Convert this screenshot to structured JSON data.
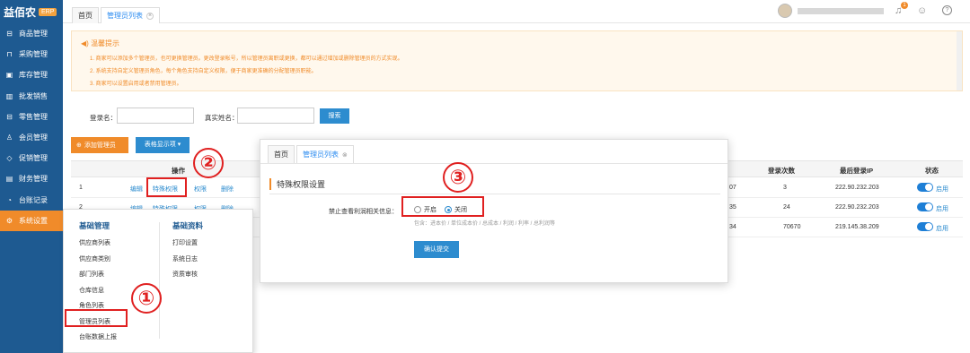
{
  "app": {
    "logo": "益佰农",
    "badge": "ERP"
  },
  "sidebar": [
    {
      "label": "商品管理",
      "icon": "bag-icon",
      "glyph": "⊟"
    },
    {
      "label": "采购管理",
      "icon": "cart-icon",
      "glyph": "⊓"
    },
    {
      "label": "库存管理",
      "icon": "box-icon",
      "glyph": "▣"
    },
    {
      "label": "批发销售",
      "icon": "chart-icon",
      "glyph": "▥"
    },
    {
      "label": "零售管理",
      "icon": "store-icon",
      "glyph": "⊟"
    },
    {
      "label": "会员管理",
      "icon": "user-icon",
      "glyph": "♙"
    },
    {
      "label": "促销管理",
      "icon": "tag-icon",
      "glyph": "◇"
    },
    {
      "label": "财务管理",
      "icon": "wallet-icon",
      "glyph": "▤"
    },
    {
      "label": "台账记录",
      "icon": "clock-icon",
      "glyph": "◔"
    },
    {
      "label": "系统设置",
      "icon": "gear-icon",
      "glyph": "⚙",
      "active": true
    }
  ],
  "tabs": {
    "home": "首页",
    "current": "管理员列表"
  },
  "notice": {
    "title": "温馨提示",
    "lines": [
      "1. 商家可以添加多个管理员，也可更换管理员。更改登录帐号，所以管理员离职或更换，都可以通过增加或删除管理员的方式实现。",
      "2. 系统支持自定义管理员角色，每个角色支持自定义权限，便于商家更准确的分配管理员职能。",
      "3. 商家可以设置启用或者禁用管理员。"
    ]
  },
  "search": {
    "login_label": "登录名：",
    "realname_label": "真实姓名：",
    "button": "搜索"
  },
  "toolbar": {
    "add": "添加管理员",
    "columns": "表格显示项 ▾"
  },
  "table": {
    "headers": {
      "op": "操作",
      "count": "登录次数",
      "ip": "最后登录IP",
      "state": "状态"
    },
    "rows": [
      {
        "no": "1",
        "edit": "编辑",
        "perm": "特殊权限",
        "auth": "权限",
        "del": "删除",
        "mid": "07",
        "count": "3",
        "ip": "222.90.232.203",
        "state": "启用"
      },
      {
        "no": "2",
        "edit": "编辑",
        "perm": "特殊权限",
        "auth": "权限",
        "del": "删除",
        "mid": "35",
        "count": "24",
        "ip": "222.90.232.203",
        "state": "启用"
      },
      {
        "no": "3",
        "edit": "编辑",
        "perm": "特殊权限",
        "auth": "权限",
        "del": "删除",
        "mid": "34",
        "count": "70670",
        "ip": "219.145.38.209",
        "state": "启用"
      }
    ]
  },
  "menu": {
    "col1_title": "基础管理",
    "col1": [
      "供应商列表",
      "供应商类别",
      "部门列表",
      "仓库信息",
      "角色列表",
      "管理员列表",
      "台账数据上报"
    ],
    "col2_title": "基础资料",
    "col2": [
      "打印设置",
      "系统日志",
      "资质审核"
    ]
  },
  "dialog": {
    "tab_home": "首页",
    "tab_current": "管理员列表",
    "title": "特殊权限设置",
    "field_label": "禁止查看利润相关信息：",
    "opt_on": "开启",
    "opt_off": "关闭",
    "hint": "包含：进本价 / 单位成本价 / 总成本 / 利润 / 利率 / 总利润等",
    "submit": "确认提交"
  },
  "callouts": [
    "①",
    "②",
    "③"
  ],
  "colors": {
    "sidebar": "#1e5a91",
    "accent": "#f08b2a",
    "primary": "#2d8ccf",
    "highlight": "#e02020"
  }
}
